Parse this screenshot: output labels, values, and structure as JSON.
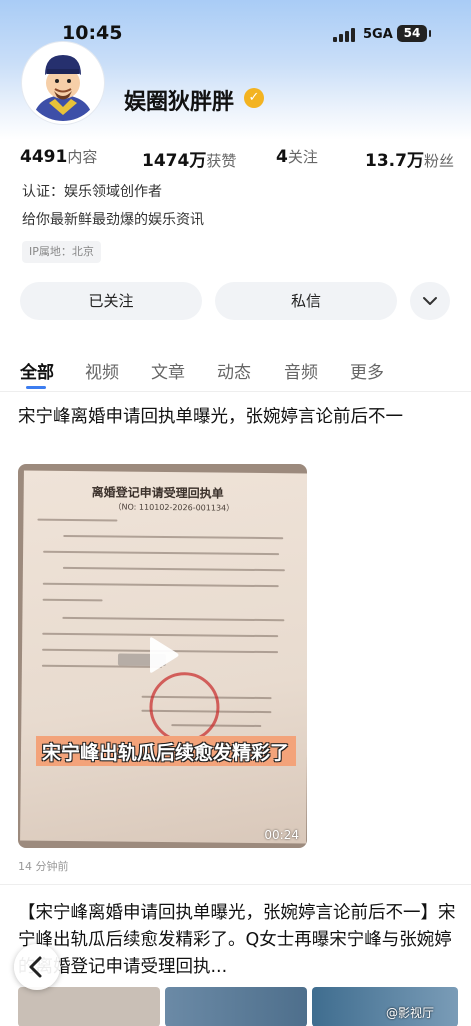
{
  "status_bar": {
    "time": "10:45",
    "network": "5GA",
    "battery": "54"
  },
  "profile": {
    "name": "娱圈狄胖胖",
    "stats": [
      {
        "value": "4491",
        "label": "内容"
      },
      {
        "value": "1474万",
        "label": "获赞"
      },
      {
        "value": "4",
        "label": "关注"
      },
      {
        "value": "13.7万",
        "label": "粉丝"
      }
    ],
    "certification": "认证：娱乐领域创作者",
    "bio": "给你最新鲜最劲爆的娱乐资讯",
    "ip_location": "IP属地：北京"
  },
  "actions": {
    "follow_label": "已关注",
    "message_label": "私信"
  },
  "tabs": [
    {
      "label": "全部",
      "active": true
    },
    {
      "label": "视频"
    },
    {
      "label": "文章"
    },
    {
      "label": "动态"
    },
    {
      "label": "音频"
    },
    {
      "label": "更多"
    }
  ],
  "posts": [
    {
      "title": "宋宁峰离婚申请回执单曝光，张婉婷言论前后不一",
      "video": {
        "doc_title": "离婚登记申请受理回执单",
        "doc_no": "（NO: 110102-2026-001134）",
        "caption": "宋宁峰出轨瓜后续愈发精彩了",
        "duration": "00:24"
      },
      "time": "14 分钟前"
    },
    {
      "text": "【宋宁峰离婚申请回执单曝光，张婉婷言论前后不一】宋宁峰出轨瓜后续愈发精彩了。Q女士再曝宋宁峰与张婉婷的离婚登记申请受理回执..."
    }
  ],
  "watermark": "@影视厅"
}
